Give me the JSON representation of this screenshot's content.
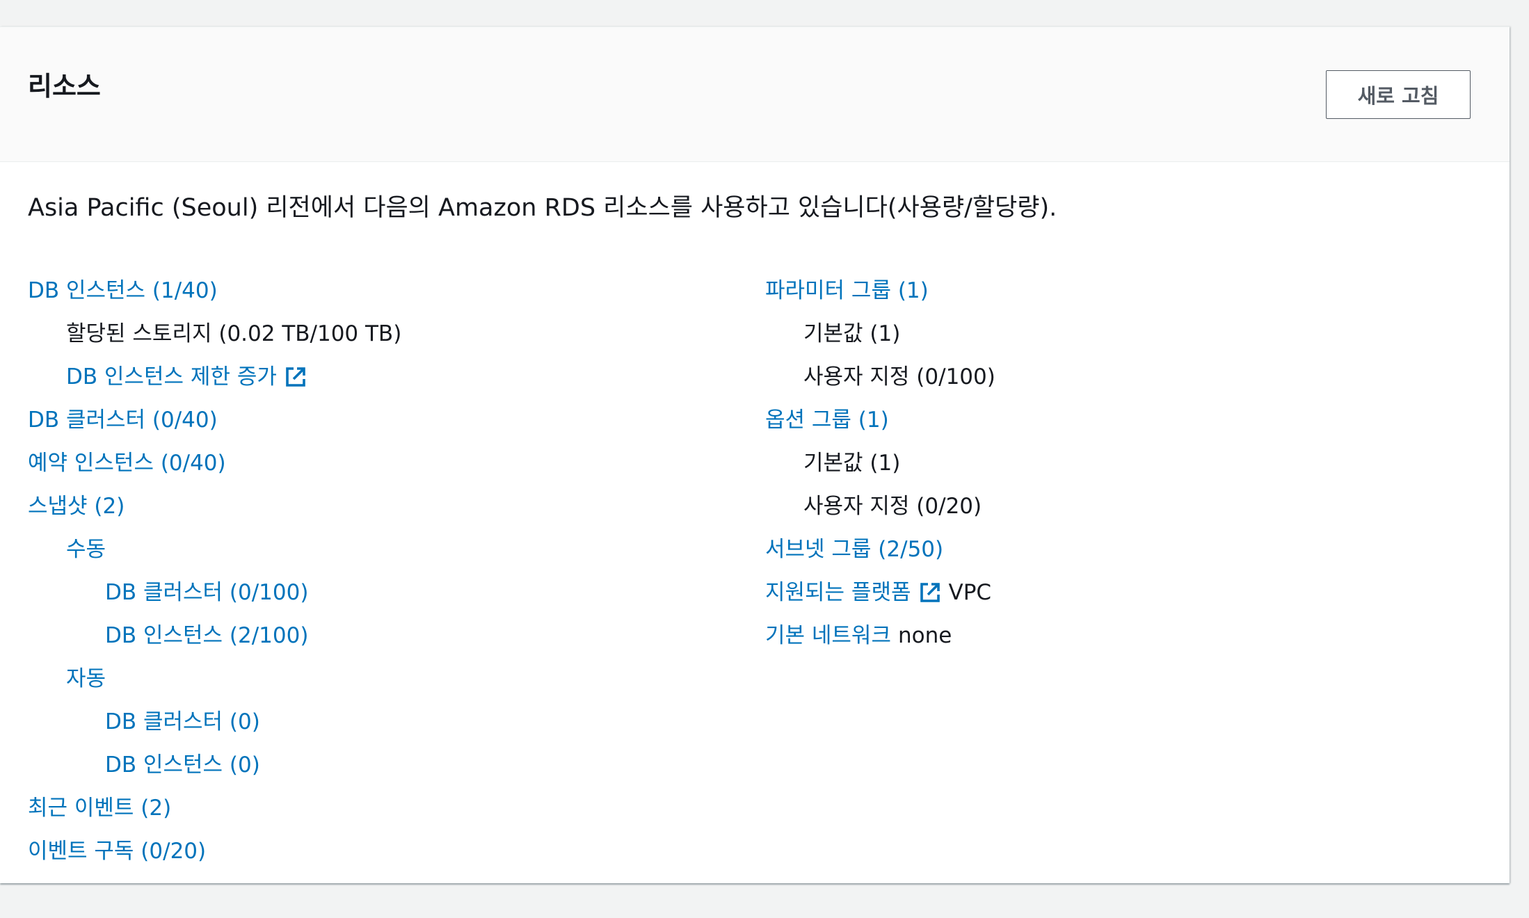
{
  "header": {
    "title": "리소스",
    "refresh_label": "새로 고침"
  },
  "intro": "Asia Pacific (Seoul) 리전에서 다음의 Amazon RDS 리소스를 사용하고 있습니다(사용량/할당량).",
  "left": {
    "db_instances": "DB 인스턴스 (1/40)",
    "allocated_storage": "할당된 스토리지 (0.02 TB/100 TB)",
    "increase_limit": "DB 인스턴스 제한 증가",
    "db_clusters": "DB 클러스터 (0/40)",
    "reserved_instances": "예약 인스턴스 (0/40)",
    "snapshots": "스냅샷 (2)",
    "manual": "수동",
    "manual_clusters": "DB 클러스터 (0/100)",
    "manual_instances": "DB 인스턴스 (2/100)",
    "automated": "자동",
    "auto_clusters": "DB 클러스터 (0)",
    "auto_instances": "DB 인스턴스 (0)",
    "recent_events": "최근 이벤트 (2)",
    "event_subscriptions": "이벤트 구독 (0/20)"
  },
  "right": {
    "parameter_groups": "파라미터 그룹 (1)",
    "param_default": "기본값 (1)",
    "param_custom": "사용자 지정 (0/100)",
    "option_groups": "옵션 그룹 (1)",
    "option_default": "기본값 (1)",
    "option_custom": "사용자 지정 (0/20)",
    "subnet_groups": "서브넷 그룹 (2/50)",
    "supported_platforms": "지원되는 플랫폼",
    "supported_platforms_value": "VPC",
    "default_network": "기본 네트워크",
    "default_network_value": "none"
  },
  "icons": {
    "external_link": "external-link-icon"
  },
  "colors": {
    "link": "#0073bb",
    "text": "#16191f",
    "button_border": "#545b64",
    "header_bg": "#fafafa",
    "page_bg": "#f2f3f3"
  }
}
